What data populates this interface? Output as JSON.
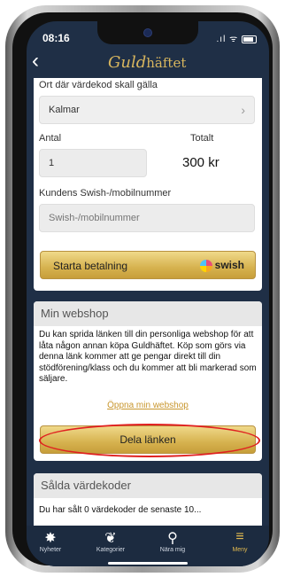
{
  "status": {
    "time": "08:16",
    "icons": ".ıl ᯤ"
  },
  "header": {
    "back": "‹",
    "logo_script": "Guld",
    "logo_rest": "häftet"
  },
  "payment": {
    "location_label": "Ort där värdekod skall gälla",
    "location_value": "Kalmar",
    "amount_label": "Antal",
    "total_label": "Totalt",
    "amount_value": "1",
    "total_value": "300 kr",
    "phone_label": "Kundens Swish-/mobilnummer",
    "phone_placeholder": "Swish-/mobilnummer",
    "pay_button": "Starta betalning",
    "swish_brand": "swish"
  },
  "webshop": {
    "title": "Min webshop",
    "description": "Du kan sprida länken till din personliga webshop för att låta någon annan köpa Guldhäftet. Köp som görs via denna länk kommer att ge pengar direkt till din stödförening/klass och du kommer att bli markerad som säljare.",
    "open_link": "Öppna min webshop",
    "share_button": "Dela länken"
  },
  "sold": {
    "title": "Sålda värdekoder",
    "partial_text": "Du har sålt 0 värdekoder de senaste 10..."
  },
  "nav": [
    {
      "label": "Nyheter",
      "icon": "news-icon",
      "glyph": "✸"
    },
    {
      "label": "Kategorier",
      "icon": "categories-icon",
      "glyph": "❦"
    },
    {
      "label": "Nära mig",
      "icon": "location-pin-icon",
      "glyph": "⚲"
    },
    {
      "label": "Meny",
      "icon": "menu-icon",
      "glyph": "≡"
    }
  ],
  "colors": {
    "background": "#1f2f46",
    "gold": "#d6b24f",
    "link": "#c8962d",
    "annotation": "#e02020"
  }
}
